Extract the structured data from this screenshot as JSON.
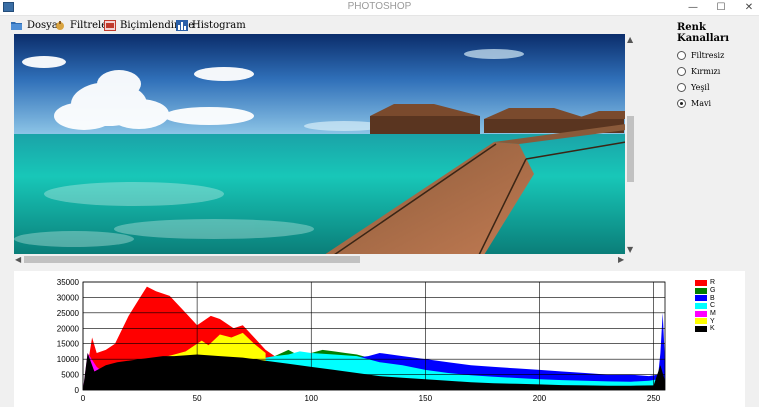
{
  "window": {
    "title": "PHOTOSHOP",
    "minimize": "—",
    "maximize": "☐",
    "close": "✕"
  },
  "menu": [
    {
      "label": "Dosya",
      "icon": "folder-icon",
      "color": "#2f6db3"
    },
    {
      "label": "Filtreler",
      "icon": "filter-icon",
      "color": "#d9a441"
    },
    {
      "label": "Biçimlendirme",
      "icon": "format-icon",
      "color": "#c0392b"
    },
    {
      "label": "Histogram",
      "icon": "histogram-icon",
      "color": "#2a5fa8"
    }
  ],
  "channels": {
    "title": "Renk Kanalları",
    "options": [
      {
        "label": "Filtresiz",
        "selected": false
      },
      {
        "label": "Kırmızı",
        "selected": false
      },
      {
        "label": "Yeşil",
        "selected": false
      },
      {
        "label": "Mavi",
        "selected": true
      }
    ]
  },
  "chart_data": {
    "type": "area",
    "title": "",
    "xlabel": "",
    "ylabel": "",
    "xlim": [
      0,
      255
    ],
    "ylim": [
      0,
      35000
    ],
    "x_ticks": [
      0,
      50,
      100,
      150,
      200,
      250
    ],
    "y_ticks": [
      0,
      5000,
      10000,
      15000,
      20000,
      25000,
      30000,
      35000
    ],
    "grid": true,
    "legend_position": "right",
    "series": [
      {
        "name": "R",
        "color": "#ff0000",
        "points": [
          [
            0,
            0
          ],
          [
            2,
            8000
          ],
          [
            4,
            17000
          ],
          [
            6,
            12000
          ],
          [
            10,
            13000
          ],
          [
            14,
            15000
          ],
          [
            20,
            24000
          ],
          [
            25,
            30000
          ],
          [
            28,
            33500
          ],
          [
            32,
            32000
          ],
          [
            38,
            30500
          ],
          [
            45,
            25000
          ],
          [
            50,
            21000
          ],
          [
            56,
            24000
          ],
          [
            60,
            23000
          ],
          [
            66,
            20000
          ],
          [
            70,
            21000
          ],
          [
            75,
            17000
          ],
          [
            80,
            13000
          ],
          [
            84,
            11000
          ]
        ]
      },
      {
        "name": "G",
        "color": "#008000",
        "points": [
          [
            0,
            0
          ],
          [
            84,
            11000
          ],
          [
            90,
            13000
          ],
          [
            95,
            11000
          ],
          [
            100,
            12000
          ],
          [
            105,
            13000
          ],
          [
            110,
            12500
          ],
          [
            115,
            12000
          ],
          [
            120,
            11500
          ],
          [
            125,
            10500
          ],
          [
            130,
            10000
          ]
        ]
      },
      {
        "name": "B",
        "color": "#0000ff",
        "points": [
          [
            0,
            0
          ],
          [
            125,
            11000
          ],
          [
            130,
            12000
          ],
          [
            140,
            11000
          ],
          [
            150,
            10000
          ],
          [
            160,
            9000
          ],
          [
            170,
            8000
          ],
          [
            180,
            7500
          ],
          [
            190,
            7000
          ],
          [
            200,
            6500
          ],
          [
            210,
            6000
          ],
          [
            220,
            5500
          ],
          [
            230,
            5000
          ],
          [
            240,
            5000
          ],
          [
            248,
            4500
          ],
          [
            252,
            5000
          ],
          [
            253,
            12000
          ],
          [
            254,
            25000
          ],
          [
            255,
            9000
          ]
        ]
      },
      {
        "name": "C",
        "color": "#00ffff",
        "points": [
          [
            0,
            0
          ],
          [
            84,
            11000
          ],
          [
            90,
            11500
          ],
          [
            95,
            12500
          ],
          [
            100,
            12000
          ],
          [
            110,
            11500
          ],
          [
            120,
            11000
          ],
          [
            130,
            9000
          ],
          [
            140,
            8000
          ],
          [
            150,
            6500
          ],
          [
            160,
            5500
          ],
          [
            170,
            4800
          ],
          [
            180,
            4300
          ],
          [
            190,
            3900
          ],
          [
            200,
            3500
          ],
          [
            210,
            3200
          ],
          [
            220,
            3000
          ],
          [
            230,
            2800
          ],
          [
            240,
            2700
          ],
          [
            248,
            3000
          ],
          [
            252,
            3500
          ]
        ]
      },
      {
        "name": "M",
        "color": "#ff00ff",
        "points": [
          [
            0,
            0
          ],
          [
            2,
            12000
          ],
          [
            6,
            7500
          ],
          [
            10,
            5000
          ],
          [
            14,
            4000
          ],
          [
            18,
            4500
          ],
          [
            22,
            5500
          ],
          [
            24,
            8000
          ]
        ]
      },
      {
        "name": "Y",
        "color": "#ffff00",
        "points": [
          [
            0,
            0
          ],
          [
            32,
            10000
          ],
          [
            40,
            11500
          ],
          [
            45,
            12500
          ],
          [
            52,
            16000
          ],
          [
            55,
            14500
          ],
          [
            60,
            18000
          ],
          [
            65,
            17000
          ],
          [
            70,
            18500
          ],
          [
            75,
            15000
          ],
          [
            80,
            12000
          ]
        ]
      },
      {
        "name": "K",
        "color": "#000000",
        "points": [
          [
            0,
            0
          ],
          [
            2,
            12000
          ],
          [
            5,
            6000
          ],
          [
            10,
            8000
          ],
          [
            15,
            9000
          ],
          [
            20,
            9500
          ],
          [
            25,
            10000
          ],
          [
            30,
            10500
          ],
          [
            35,
            11000
          ],
          [
            40,
            11000
          ],
          [
            50,
            11500
          ],
          [
            60,
            11000
          ],
          [
            70,
            10500
          ],
          [
            80,
            9500
          ],
          [
            90,
            8500
          ],
          [
            100,
            7500
          ],
          [
            110,
            6500
          ],
          [
            120,
            5500
          ],
          [
            130,
            4500
          ],
          [
            140,
            4000
          ],
          [
            150,
            3500
          ],
          [
            160,
            3000
          ],
          [
            170,
            2500
          ],
          [
            180,
            2200
          ],
          [
            190,
            2000
          ],
          [
            200,
            1800
          ],
          [
            210,
            1600
          ],
          [
            220,
            1500
          ],
          [
            230,
            1400
          ],
          [
            240,
            1400
          ],
          [
            250,
            1500
          ],
          [
            253,
            8000
          ],
          [
            255,
            3000
          ]
        ]
      }
    ]
  }
}
